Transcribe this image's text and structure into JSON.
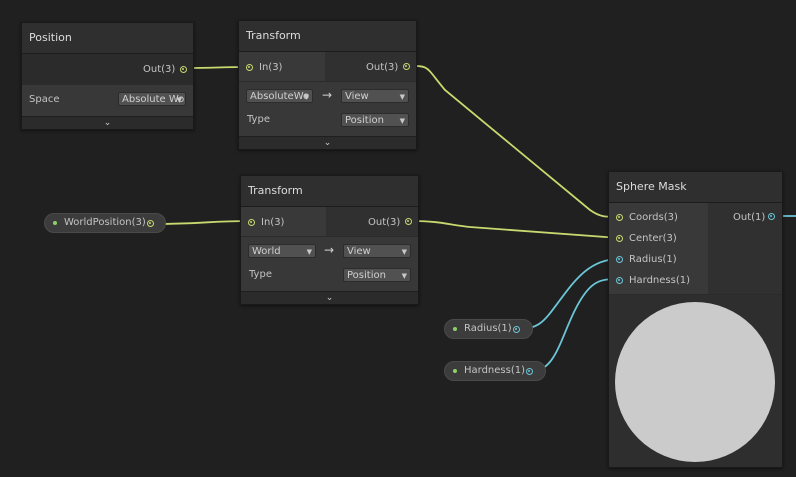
{
  "colors": {
    "background": "#202020",
    "vector_wire": "#c8d96f",
    "scalar_wire": "#6bc6d8",
    "preview": "#cbcbcb"
  },
  "position_node": {
    "title": "Position",
    "out_port": "Out(3)",
    "space_label": "Space",
    "space_value": "Absolute Wo"
  },
  "transform_node_1": {
    "title": "Transform",
    "in_port": "In(3)",
    "out_port": "Out(3)",
    "from_space": "AbsoluteWo",
    "to_space": "View",
    "arrow": "→",
    "type_label": "Type",
    "type_value": "Position"
  },
  "transform_node_2": {
    "title": "Transform",
    "in_port": "In(3)",
    "out_port": "Out(3)",
    "from_space": "World",
    "to_space": "View",
    "arrow": "→",
    "type_label": "Type",
    "type_value": "Position"
  },
  "world_position_property": {
    "label": "WorldPosition(3)"
  },
  "radius_property": {
    "label": "Radius(1)"
  },
  "hardness_property": {
    "label": "Hardness(1)"
  },
  "sphere_mask_node": {
    "title": "Sphere Mask",
    "inputs": [
      "Coords(3)",
      "Center(3)",
      "Radius(1)",
      "Hardness(1)"
    ],
    "out_port": "Out(1)"
  },
  "collapse_icon": "chevron-down-icon"
}
